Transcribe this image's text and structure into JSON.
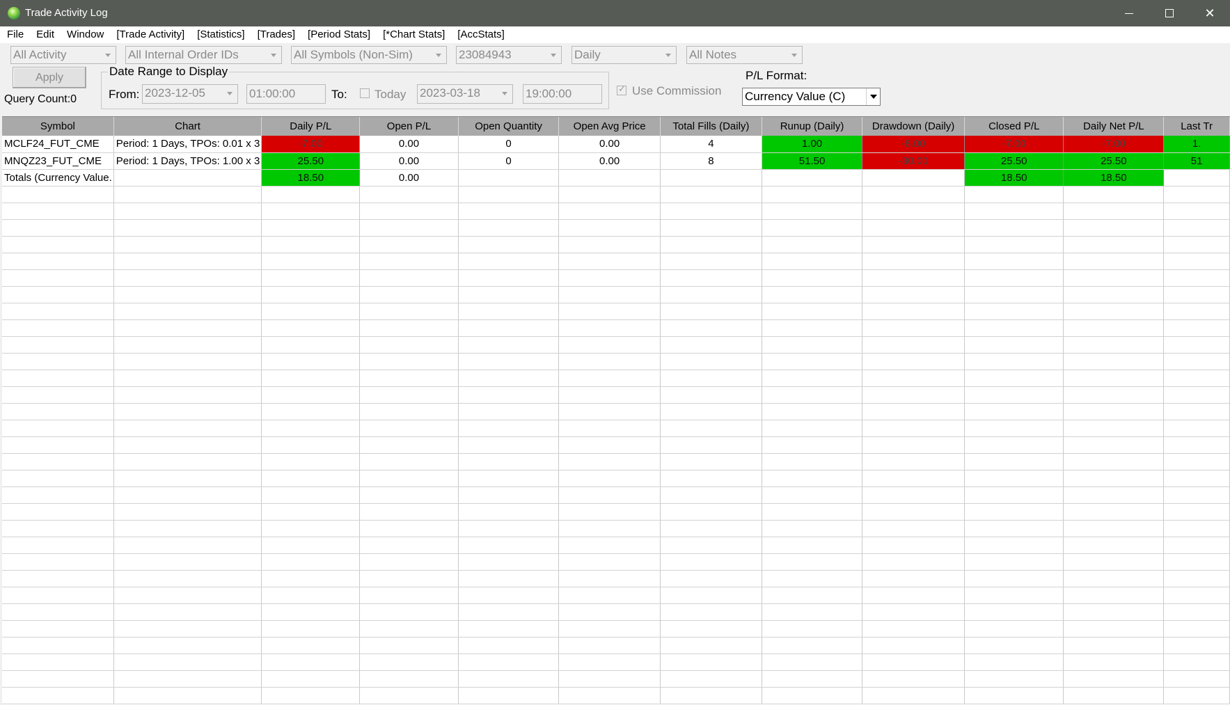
{
  "window": {
    "title": "Trade Activity Log"
  },
  "menu": [
    "File",
    "Edit",
    "Window",
    "[Trade Activity]",
    "[Statistics]",
    "[Trades]",
    "[Period Stats]",
    "[*Chart Stats]",
    "[AccStats]"
  ],
  "filters": {
    "activity": "All Activity",
    "order_ids": "All Internal Order IDs",
    "symbols": "All Symbols (Non-Sim)",
    "account": "23084943",
    "period": "Daily",
    "notes": "All Notes"
  },
  "apply_label": "Apply",
  "query_count": "Query Count:0",
  "date_range": {
    "legend": "Date Range to Display",
    "from_label": "From:",
    "from_date": "2023-12-05",
    "from_time": "01:00:00",
    "to_label": "To:",
    "today_label": "Today",
    "today_checked": false,
    "to_date": "2023-03-18",
    "to_time": "19:00:00"
  },
  "use_commission": {
    "label": "Use Commission",
    "checked": true
  },
  "pl_format": {
    "label": "P/L Format:",
    "value": "Currency Value (C)"
  },
  "colors": {
    "positive": "#00c800",
    "negative": "#d60000",
    "header": "#a9a9a9",
    "titlebar": "#565b55"
  },
  "grid": {
    "columns": [
      "Symbol",
      "Chart",
      "Daily P/L",
      "Open P/L",
      "Open Quantity",
      "Open Avg Price",
      "Total Fills (Daily)",
      "Runup (Daily)",
      "Drawdown (Daily)",
      "Closed P/L",
      "Daily Net P/L",
      "Last Tr"
    ],
    "rows": [
      {
        "cells": [
          "MCLF24_FUT_CME",
          "Period: 1 Days, TPOs: 0.01 x 3",
          "-7.00",
          "0.00",
          "0",
          "0.00",
          "4",
          "1.00",
          "-8.00",
          "-7.00",
          "-7.00",
          "1."
        ],
        "colors": [
          "",
          "",
          "red",
          "",
          "",
          "",
          "",
          "green",
          "red",
          "red",
          "red",
          "green"
        ]
      },
      {
        "cells": [
          "MNQZ23_FUT_CME",
          "Period: 1 Days, TPOs: 1.00 x 3",
          "25.50",
          "0.00",
          "0",
          "0.00",
          "8",
          "51.50",
          "-30.00",
          "25.50",
          "25.50",
          "51"
        ],
        "colors": [
          "",
          "",
          "green",
          "",
          "",
          "",
          "",
          "green",
          "red",
          "green",
          "green",
          "green"
        ]
      },
      {
        "cells": [
          "Totals (Currency Value.",
          "",
          "18.50",
          "0.00",
          "",
          "",
          "",
          "",
          "",
          "18.50",
          "18.50",
          ""
        ],
        "colors": [
          "",
          "",
          "green",
          "",
          "",
          "",
          "",
          "",
          "",
          "green",
          "green",
          ""
        ]
      }
    ]
  }
}
